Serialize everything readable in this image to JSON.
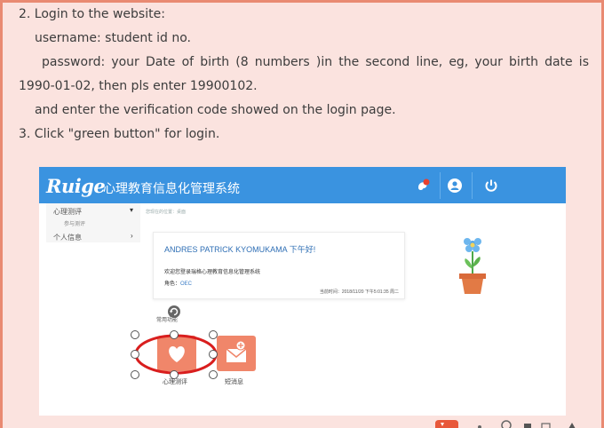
{
  "instructions": {
    "step2_title": "2. Login to the website:",
    "username": "username: student id no.",
    "password_line1": "password: your Date of birth (8 numbers )in the second line, eg, your birth date is",
    "password_line2": "1990-01-02, then pls enter 19900102.",
    "verification": "and enter the verification code showed on the login page.",
    "step3": "3. Click \"green button\" for login."
  },
  "screenshot": {
    "logo": "Ruige",
    "system_name": "心理教育信息化管理系统",
    "sidebar": {
      "items": [
        {
          "label": "心理测评"
        },
        {
          "label": "参与测评"
        },
        {
          "label": "个人信息"
        }
      ]
    },
    "breadcrumb": "您现在的位置：桌面",
    "greeting": {
      "title": "ANDRES PATRICK KYOMUKAMA 下午好!",
      "welcome": "欢迎您登录瑞格心理教育信息化管理系统",
      "role_label": "角色：",
      "role_value": "OEC",
      "time": "当前时间：2018/11/20 下午5:01:35 周二"
    },
    "quick_label": "常用功能",
    "tiles": [
      {
        "label": "心理测评",
        "icon": "heart-icon"
      },
      {
        "label": "短消息",
        "icon": "envelope-icon"
      }
    ],
    "colors": {
      "topbar": "#3a93e0",
      "tile": "#f0866a",
      "highlight_ellipse": "#d91e1e"
    }
  }
}
